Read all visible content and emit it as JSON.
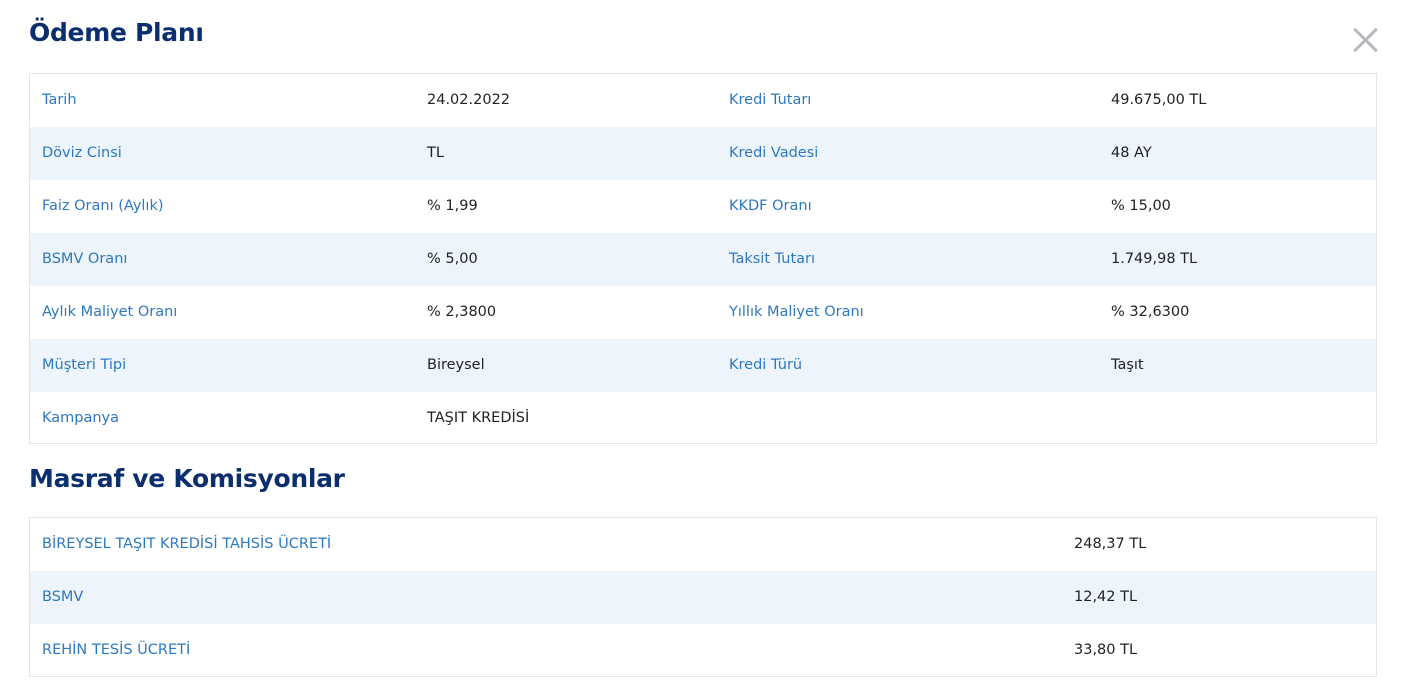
{
  "payment_plan": {
    "title": "Ödeme Planı",
    "rows": [
      {
        "l1": "Tarih",
        "v1": "24.02.2022",
        "l2": "Kredi Tutarı",
        "v2": "49.675,00 TL"
      },
      {
        "l1": "Döviz Cinsi",
        "v1": "TL",
        "l2": "Kredi Vadesi",
        "v2": "48 AY"
      },
      {
        "l1": "Faiz Oranı (Aylık)",
        "v1": "% 1,99",
        "l2": "KKDF Oranı",
        "v2": "% 15,00"
      },
      {
        "l1": "BSMV Oranı",
        "v1": "% 5,00",
        "l2": "Taksit Tutarı",
        "v2": "1.749,98 TL"
      },
      {
        "l1": "Aylık Maliyet Oranı",
        "v1": "% 2,3800",
        "l2": "Yıllık Maliyet Oranı",
        "v2": "% 32,6300"
      },
      {
        "l1": "Müşteri Tipi",
        "v1": "Bireysel",
        "l2": "Kredi Türü",
        "v2": "Taşıt"
      },
      {
        "l1": "Kampanya",
        "v1": "TAŞIT KREDİSİ",
        "l2": "",
        "v2": ""
      }
    ]
  },
  "fees": {
    "title": "Masraf ve Komisyonlar",
    "rows": [
      {
        "label": "BİREYSEL TAŞIT KREDİSİ TAHSİS ÜCRETİ",
        "value": "248,37 TL"
      },
      {
        "label": "BSMV",
        "value": "12,42 TL"
      },
      {
        "label": "REHİN TESİS ÜCRETİ",
        "value": "33,80 TL"
      }
    ]
  },
  "close_icon": "close-icon",
  "colors": {
    "title": "#0a2e6e",
    "label": "#2d78c2",
    "row_alt": "#edf4fb",
    "border": "#e2e5ea",
    "close": "#b5b9bf"
  }
}
